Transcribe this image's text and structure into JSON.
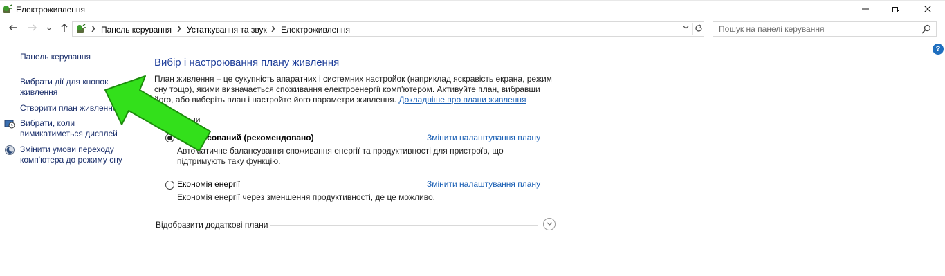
{
  "window": {
    "title": "Електроживлення",
    "icons": {
      "app": "power-options-icon",
      "minimize": "minimize-icon",
      "maximize": "maximize-icon",
      "close": "close-icon"
    }
  },
  "nav": {
    "icons": {
      "back": "back-arrow-icon",
      "forward": "forward-arrow-icon",
      "recent": "chevron-down-icon",
      "up": "up-arrow-icon",
      "refresh": "refresh-icon",
      "dropdown": "chevron-down-icon"
    },
    "breadcrumb": [
      "Панель керування",
      "Устаткування та звук",
      "Електроживлення"
    ]
  },
  "search": {
    "placeholder": "Пошук на панелі керування"
  },
  "help": {
    "label": "?"
  },
  "sidebar": {
    "items": [
      {
        "label": "Панель керування"
      },
      {
        "label": "Вибрати дії для кнопок\nживлення"
      },
      {
        "label": "Створити план живлення"
      },
      {
        "label": "Вибрати, коли\nвимикатиметься дисплей",
        "icon": "display-clock-icon"
      },
      {
        "label": "Змінити умови переходу\nкомп'ютера до режиму сну",
        "icon": "sleep-moon-icon"
      }
    ]
  },
  "main": {
    "heading": "Вибір і настроювання плану живлення",
    "description": "План живлення – це сукупність апаратних і системних настройок (наприклад яскравість екрана, режим сну тощо), якими визначається споживання електроенергії комп'ютером. Активуйте план, вибравши його, або виберіть план і настройте його параметри живлення.",
    "learn_more": "Докладніше про плани живлення",
    "group_label": "плани",
    "plans": [
      {
        "name": "Збалансований (рекомендовано)",
        "selected": true,
        "description": "Автоматичне балансування споживання енергії та продуктивності для пристроїв, що\nпідтримують таку функцію.",
        "change_link": "Змінити налаштування плану"
      },
      {
        "name": "Економія енергії",
        "selected": false,
        "description": "Економія енергії через зменшення продуктивності, де це можливо.",
        "change_link": "Змінити налаштування плану"
      }
    ],
    "more_plans": "Відобразити додаткові плани"
  },
  "annotation": {
    "color": "#33e01b"
  }
}
